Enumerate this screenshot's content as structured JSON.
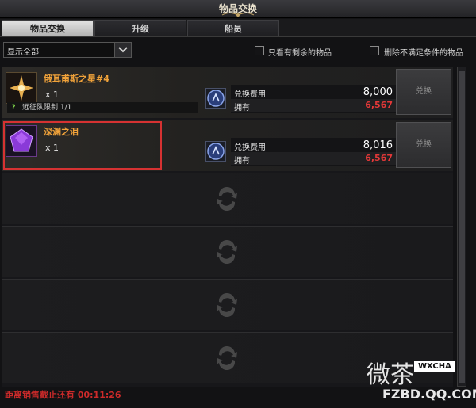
{
  "window": {
    "title": "物品交换"
  },
  "tabs": [
    {
      "label": "物品交换",
      "active": true
    },
    {
      "label": "升级",
      "active": false
    },
    {
      "label": "船员",
      "active": false
    }
  ],
  "filter": {
    "selected": "显示全部"
  },
  "options": {
    "only_remaining": "只看有剩余的物品",
    "remove_unmet": "删除不满足条件的物品"
  },
  "items": [
    {
      "name": "俄耳甫斯之星#4",
      "qty": "x 1",
      "limit_label": "远征队限制 1/1",
      "cost_label": "兑换费用",
      "cost_value": "8,000",
      "owned_label": "拥有",
      "owned_value": "6,567",
      "button": "兑换"
    },
    {
      "name": "深渊之泪",
      "qty": "x 1",
      "cost_label": "兑换费用",
      "cost_value": "8,016",
      "owned_label": "拥有",
      "owned_value": "6,567",
      "button": "兑换"
    }
  ],
  "footer": {
    "countdown": "距离销售截止还有 00:11:26"
  },
  "watermark": {
    "brand": "微茶",
    "badge": "WXCHA",
    "url": "FZBD.QQ.COM"
  },
  "colors": {
    "accent_orange": "#f0a23a",
    "owned_red": "#e23838",
    "highlight_red": "#d63232",
    "footer_red": "#cc2a2a"
  }
}
